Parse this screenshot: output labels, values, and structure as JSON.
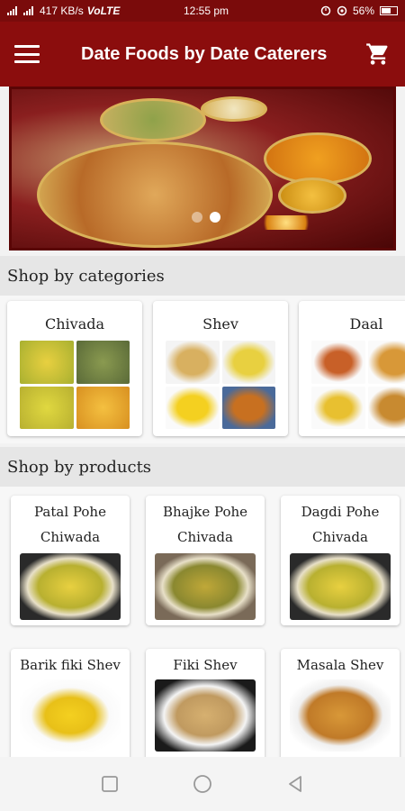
{
  "status_bar": {
    "network_speed": "417 KB/s",
    "network_type": "VoLTE",
    "time": "12:55 pm",
    "battery": "56%"
  },
  "app_bar": {
    "title": "Date Foods by Date Caterers",
    "menu_icon": "hamburger-menu-icon",
    "cart_icon": "shopping-cart-icon"
  },
  "banner": {
    "slide_count": 2,
    "active_slide": 2
  },
  "categories": {
    "title": "Shop by categories",
    "items": [
      {
        "name": "Chivada"
      },
      {
        "name": "Shev"
      },
      {
        "name": "Daal"
      }
    ]
  },
  "products": {
    "title": "Shop by products",
    "items": [
      {
        "name": "Patal Pohe Chiwada"
      },
      {
        "name": "Bhajke Pohe Chivada"
      },
      {
        "name": "Dagdi Pohe Chivada"
      },
      {
        "name": "Barik fiki Shev"
      },
      {
        "name": "Fiki Shev"
      },
      {
        "name": "Masala Shev"
      }
    ]
  },
  "colors": {
    "app_bar": "#8b0d0d",
    "status_bar": "#7a0b0b",
    "section_header": "#e6e6e6"
  }
}
